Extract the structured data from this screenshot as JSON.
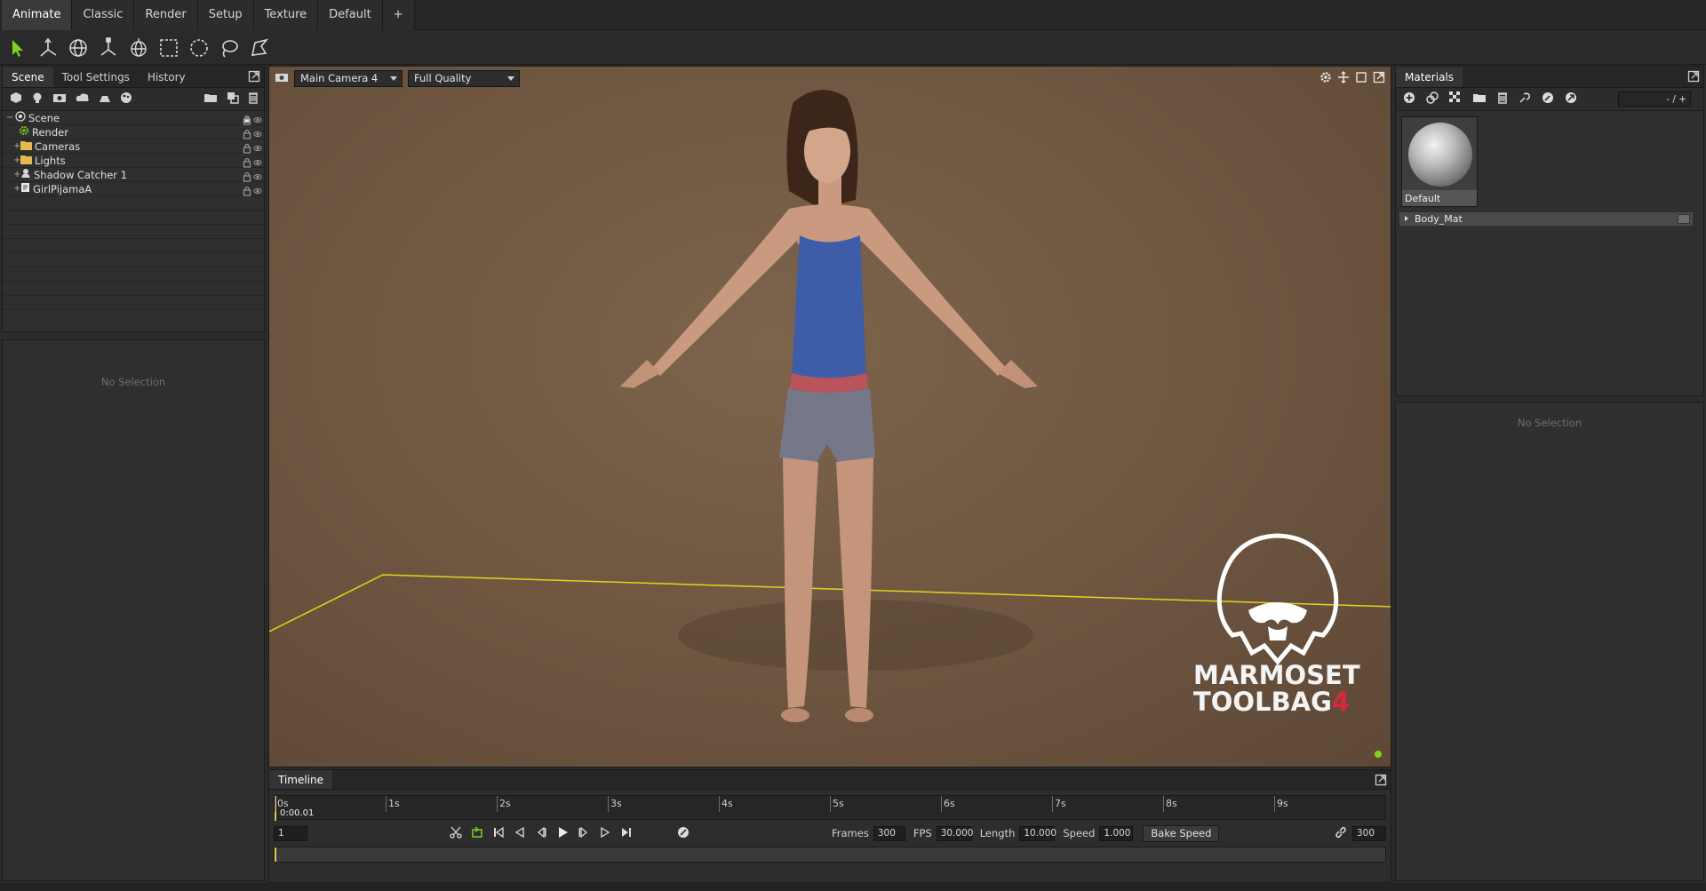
{
  "menu": {
    "tabs": [
      "Animate",
      "Classic",
      "Render",
      "Setup",
      "Texture",
      "Default",
      "+"
    ]
  },
  "toolbar": {
    "tools": [
      "select-tool-icon",
      "translate-tool-icon",
      "rotate-tool-icon",
      "scale-tool-icon",
      "manipulator-tool-icon",
      "box-select-icon",
      "circle-select-icon",
      "lasso-select-icon",
      "polygon-select-icon"
    ]
  },
  "scene_panel": {
    "tabs": [
      "Scene",
      "Tool Settings",
      "History"
    ],
    "tree": [
      {
        "label": "Scene",
        "icon": "scene-icon"
      },
      {
        "label": "Render",
        "icon": "render-gear-icon"
      },
      {
        "label": "Cameras",
        "icon": "folder-icon"
      },
      {
        "label": "Lights",
        "icon": "folder-icon"
      },
      {
        "label": "Shadow Catcher 1",
        "icon": "shadow-catcher-icon"
      },
      {
        "label": "GirlPijamaA",
        "icon": "mesh-icon"
      }
    ]
  },
  "properties": {
    "empty_text": "No Selection"
  },
  "viewport": {
    "camera": "Main Camera 4",
    "quality": "Full Quality",
    "watermark_line1": "MARMOSET",
    "watermark_line2": "TOOLBAG",
    "watermark_version": "4"
  },
  "timeline": {
    "title": "Timeline",
    "ticks": [
      "0s",
      "1s",
      "2s",
      "3s",
      "4s",
      "5s",
      "6s",
      "7s",
      "8s",
      "9s"
    ],
    "current_time": "0:00.01",
    "frame_field": "1",
    "frames_label": "Frames",
    "frames_value": "300",
    "fps_label": "FPS",
    "fps_value": "30.000",
    "length_label": "Length",
    "length_value": "10.000",
    "speed_label": "Speed",
    "speed_value": "1.000",
    "bake_label": "Bake Speed",
    "end_frame": "300"
  },
  "materials": {
    "tab": "Materials",
    "page_indicator": "- / +",
    "thumbnail_name": "Default",
    "list": [
      "Body_Mat"
    ],
    "empty_text": "No Selection"
  },
  "colors": {
    "accent_green": "#7ed321",
    "timeline_marker": "#e6c84a",
    "viewport_bg": "#6d5540",
    "ground_line": "#e3d31e"
  }
}
